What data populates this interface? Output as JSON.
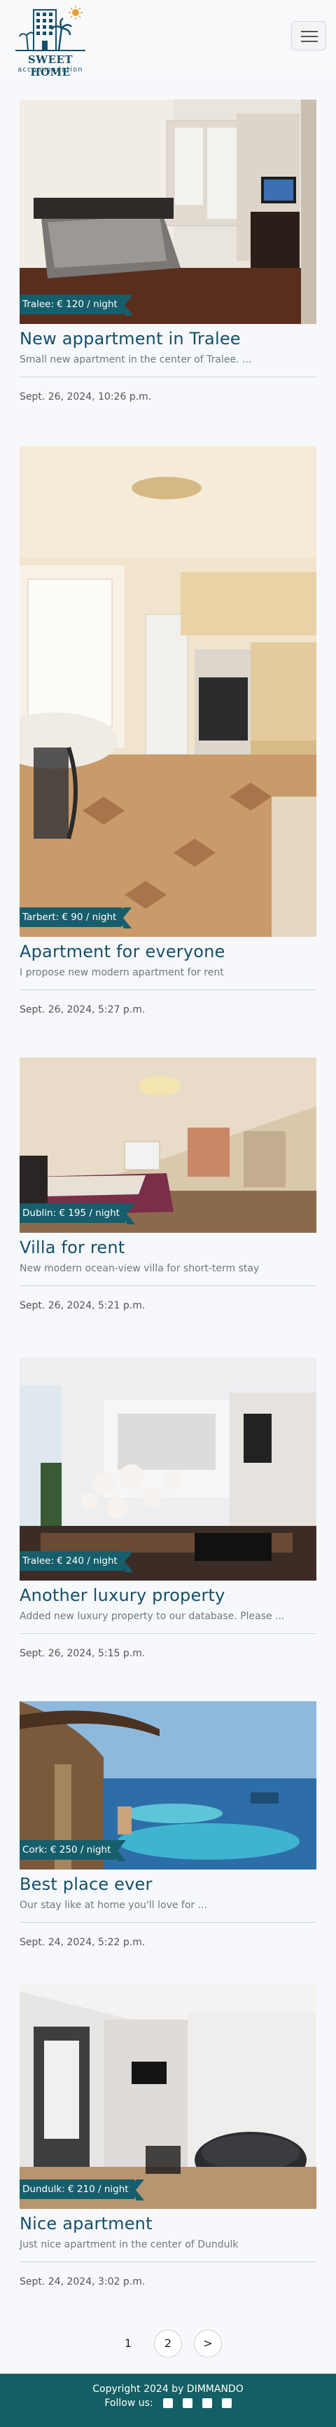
{
  "header": {
    "logo_title": "SWEET HOME",
    "logo_subtitle": "accommodation"
  },
  "listings": [
    {
      "badge": "Tralee: € 120 / night",
      "title": "New appartment in Tralee",
      "desc": "Small new apartment in the center of Tralee. ...",
      "date": "Sept. 26, 2024, 10:26 p.m."
    },
    {
      "badge": "Tarbert: € 90 / night",
      "title": "Apartment for everyone",
      "desc": "I propose new modern apartment for rent",
      "date": "Sept. 26, 2024, 5:27 p.m."
    },
    {
      "badge": "Dublin: € 195 / night",
      "title": "Villa for rent",
      "desc": "New modern ocean-view villa for short-term stay",
      "date": "Sept. 26, 2024, 5:21 p.m."
    },
    {
      "badge": "Tralee: € 240 / night",
      "title": "Another luxury property",
      "desc": "Added new luxury property to our database. Please ...",
      "date": "Sept. 26, 2024, 5:15 p.m."
    },
    {
      "badge": "Cork: € 250 / night",
      "title": "Best place ever",
      "desc": "Our stay like at home you'll love for ...",
      "date": "Sept. 24, 2024, 5:22 p.m."
    },
    {
      "badge": "Dundulk: € 210 / night",
      "title": "Nice apartment",
      "desc": "Just nice apartment in the center of Dundulk",
      "date": "Sept. 24, 2024, 3:02 p.m."
    }
  ],
  "pagination": {
    "pages": [
      "1",
      "2"
    ],
    "next": ">"
  },
  "footer": {
    "copyright": "Copyright 2024 by DIMMANDO",
    "follow": "Follow us:"
  },
  "colors": {
    "brand": "#14506a",
    "badge": "#165e6b",
    "footer": "#145f63"
  }
}
